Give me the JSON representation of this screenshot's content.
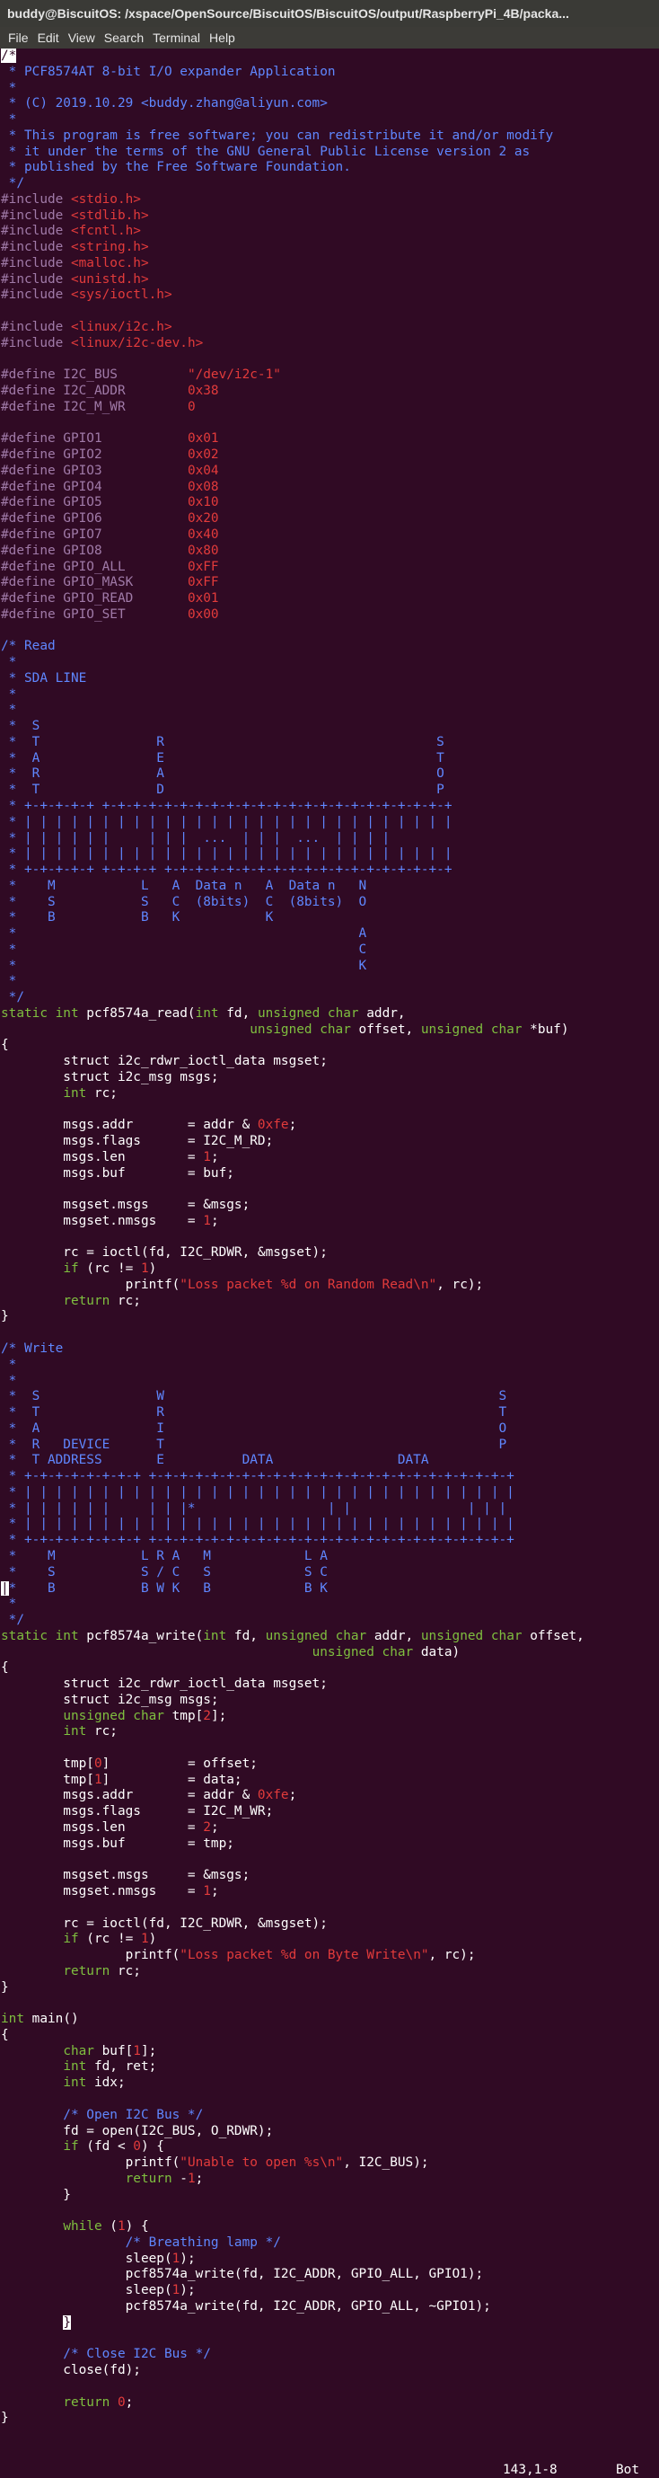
{
  "window": {
    "title": "buddy@BiscuitOS: /xspace/OpenSource/BiscuitOS/BiscuitOS/output/RaspberryPi_4B/packa..."
  },
  "menu": [
    "File",
    "Edit",
    "View",
    "Search",
    "Terminal",
    "Help"
  ],
  "status": {
    "position": "143,1-8",
    "scroll": "Bot"
  },
  "lines": [
    [
      [
        "/*",
        "cursor"
      ]
    ],
    [
      [
        " * PCF8574AT 8-bit I/O expander Application",
        "c"
      ]
    ],
    [
      [
        " *",
        "c"
      ]
    ],
    [
      [
        " * (C) 2019.10.29 <buddy.zhang@aliyun.com>",
        "c"
      ]
    ],
    [
      [
        " *",
        "c"
      ]
    ],
    [
      [
        " * This program is free software; you can redistribute it and/or modify",
        "c"
      ]
    ],
    [
      [
        " * it under the terms of the GNU General Public License version 2 as",
        "c"
      ]
    ],
    [
      [
        " * published by the Free Software Foundation.",
        "c"
      ]
    ],
    [
      [
        " */",
        "c"
      ]
    ],
    [
      [
        "#include ",
        "pp"
      ],
      [
        "<stdio.h>",
        "s"
      ]
    ],
    [
      [
        "#include ",
        "pp"
      ],
      [
        "<stdlib.h>",
        "s"
      ]
    ],
    [
      [
        "#include ",
        "pp"
      ],
      [
        "<fcntl.h>",
        "s"
      ]
    ],
    [
      [
        "#include ",
        "pp"
      ],
      [
        "<string.h>",
        "s"
      ]
    ],
    [
      [
        "#include ",
        "pp"
      ],
      [
        "<malloc.h>",
        "s"
      ]
    ],
    [
      [
        "#include ",
        "pp"
      ],
      [
        "<unistd.h>",
        "s"
      ]
    ],
    [
      [
        "#include ",
        "pp"
      ],
      [
        "<sys/ioctl.h>",
        "s"
      ]
    ],
    [],
    [
      [
        "#include ",
        "pp"
      ],
      [
        "<linux/i2c.h>",
        "s"
      ]
    ],
    [
      [
        "#include ",
        "pp"
      ],
      [
        "<linux/i2c-dev.h>",
        "s"
      ]
    ],
    [],
    [
      [
        "#define I2C_BUS         ",
        "pp"
      ],
      [
        "\"/dev/i2c-1\"",
        "s"
      ]
    ],
    [
      [
        "#define I2C_ADDR        ",
        "pp"
      ],
      [
        "0x38",
        "n"
      ]
    ],
    [
      [
        "#define I2C_M_WR        ",
        "pp"
      ],
      [
        "0",
        "n"
      ]
    ],
    [],
    [
      [
        "#define GPIO1           ",
        "pp"
      ],
      [
        "0x01",
        "n"
      ]
    ],
    [
      [
        "#define GPIO2           ",
        "pp"
      ],
      [
        "0x02",
        "n"
      ]
    ],
    [
      [
        "#define GPIO3           ",
        "pp"
      ],
      [
        "0x04",
        "n"
      ]
    ],
    [
      [
        "#define GPIO4           ",
        "pp"
      ],
      [
        "0x08",
        "n"
      ]
    ],
    [
      [
        "#define GPIO5           ",
        "pp"
      ],
      [
        "0x10",
        "n"
      ]
    ],
    [
      [
        "#define GPIO6           ",
        "pp"
      ],
      [
        "0x20",
        "n"
      ]
    ],
    [
      [
        "#define GPIO7           ",
        "pp"
      ],
      [
        "0x40",
        "n"
      ]
    ],
    [
      [
        "#define GPIO8           ",
        "pp"
      ],
      [
        "0x80",
        "n"
      ]
    ],
    [
      [
        "#define GPIO_ALL        ",
        "pp"
      ],
      [
        "0xFF",
        "n"
      ]
    ],
    [
      [
        "#define GPIO_MASK       ",
        "pp"
      ],
      [
        "0xFF",
        "n"
      ]
    ],
    [
      [
        "#define GPIO_READ       ",
        "pp"
      ],
      [
        "0x01",
        "n"
      ]
    ],
    [
      [
        "#define GPIO_SET        ",
        "pp"
      ],
      [
        "0x00",
        "n"
      ]
    ],
    [],
    [
      [
        "/* Read",
        "c"
      ]
    ],
    [
      [
        " *",
        "c"
      ]
    ],
    [
      [
        " * SDA LINE",
        "c"
      ]
    ],
    [
      [
        " *",
        "c"
      ]
    ],
    [
      [
        " *",
        "c"
      ]
    ],
    [
      [
        " *  S",
        "c"
      ]
    ],
    [
      [
        " *  T               R                                   S",
        "c"
      ]
    ],
    [
      [
        " *  A               E                                   T",
        "c"
      ]
    ],
    [
      [
        " *  R               A                                   O",
        "c"
      ]
    ],
    [
      [
        " *  T               D                                   P",
        "c"
      ]
    ],
    [
      [
        " * +-+-+-+-+ +-+-+-+-+-+-+-+-+-+-+-+-+-+-+-+-+-+-+-+-+-+-+",
        "c"
      ]
    ],
    [
      [
        " * | | | | | | | | | | | | | | | | | | | | | | | | | | | |",
        "c"
      ]
    ],
    [
      [
        " * | | | | | |     | | |  ...  | | |  ...  | | | |",
        "c"
      ]
    ],
    [
      [
        " * | | | | | | | | | | | | | | | | | | | | | | | | | | | |",
        "c"
      ]
    ],
    [
      [
        " * +-+-+-+-+ +-+-+-+ +-+-+-+-+-+-+-+-+-+-+-+-+-+-+-+-+-+-+",
        "c"
      ]
    ],
    [
      [
        " *    M           L   A  Data n   A  Data n   N",
        "c"
      ]
    ],
    [
      [
        " *    S           S   C  (8bits)  C  (8bits)  O",
        "c"
      ]
    ],
    [
      [
        " *    B           B   K           K",
        "c"
      ]
    ],
    [
      [
        " *                                            A",
        "c"
      ]
    ],
    [
      [
        " *                                            C",
        "c"
      ]
    ],
    [
      [
        " *                                            K",
        "c"
      ]
    ],
    [
      [
        " *",
        "c"
      ]
    ],
    [
      [
        " */",
        "c"
      ]
    ],
    [
      [
        "static int",
        "t"
      ],
      [
        " pcf8574a_read(",
        "p"
      ],
      [
        "int",
        "t"
      ],
      [
        " fd, ",
        "p"
      ],
      [
        "unsigned char",
        "t"
      ],
      [
        " addr,",
        "p"
      ]
    ],
    [
      [
        "                                ",
        "p"
      ],
      [
        "unsigned char",
        "t"
      ],
      [
        " offset, ",
        "p"
      ],
      [
        "unsigned char",
        "t"
      ],
      [
        " *buf)",
        "p"
      ]
    ],
    [
      [
        "{",
        "p"
      ]
    ],
    [
      [
        "        struct i2c_rdwr_ioctl_data msgset;",
        "p"
      ]
    ],
    [
      [
        "        struct i2c_msg msgs;",
        "p"
      ]
    ],
    [
      [
        "        ",
        "p"
      ],
      [
        "int",
        "t"
      ],
      [
        " rc;",
        "p"
      ]
    ],
    [],
    [
      [
        "        msgs.addr       = addr & ",
        "p"
      ],
      [
        "0xfe",
        "n"
      ],
      [
        ";",
        "p"
      ]
    ],
    [
      [
        "        msgs.flags      = I2C_M_RD;",
        "p"
      ]
    ],
    [
      [
        "        msgs.len        = ",
        "p"
      ],
      [
        "1",
        "n"
      ],
      [
        ";",
        "p"
      ]
    ],
    [
      [
        "        msgs.buf        = buf;",
        "p"
      ]
    ],
    [],
    [
      [
        "        msgset.msgs     = &msgs;",
        "p"
      ]
    ],
    [
      [
        "        msgset.nmsgs    = ",
        "p"
      ],
      [
        "1",
        "n"
      ],
      [
        ";",
        "p"
      ]
    ],
    [],
    [
      [
        "        rc = ioctl(fd, I2C_RDWR, &msgset);",
        "p"
      ]
    ],
    [
      [
        "        ",
        "p"
      ],
      [
        "if",
        "t"
      ],
      [
        " (rc != ",
        "p"
      ],
      [
        "1",
        "n"
      ],
      [
        ")",
        "p"
      ]
    ],
    [
      [
        "                printf(",
        "p"
      ],
      [
        "\"Loss packet %d on Random Read\\n\"",
        "s"
      ],
      [
        ", rc);",
        "p"
      ]
    ],
    [
      [
        "        ",
        "p"
      ],
      [
        "return",
        "t"
      ],
      [
        " rc;",
        "p"
      ]
    ],
    [
      [
        "}",
        "p"
      ]
    ],
    [],
    [
      [
        "/* Write",
        "c"
      ]
    ],
    [
      [
        " *",
        "c"
      ]
    ],
    [
      [
        " *",
        "c"
      ]
    ],
    [
      [
        " *  S               W                                           S",
        "c"
      ]
    ],
    [
      [
        " *  T               R                                           T",
        "c"
      ]
    ],
    [
      [
        " *  A               I                                           O",
        "c"
      ]
    ],
    [
      [
        " *  R   DEVICE      T                                           P",
        "c"
      ]
    ],
    [
      [
        " *  T ADDRESS       E          DATA                DATA",
        "c"
      ]
    ],
    [
      [
        " * +-+-+-+-+-+-+-+ +-+-+-+-+-+-+-+-+-+-+-+-+-+-+-+-+-+-+-+-+-+-+-+",
        "c"
      ]
    ],
    [
      [
        " * | | | | | | | | | | | | | | | | | | | | | | | | | | | | | | | |",
        "c"
      ]
    ],
    [
      [
        " * | | | | | |     | | |*                 | |               | | |",
        "c"
      ]
    ],
    [
      [
        " * | | | | | | | | | | | | | | | | | | | | | | | | | | | | | | | |",
        "c"
      ]
    ],
    [
      [
        " * +-+-+-+-+-+-+-+ +-+-+-+-+-+-+-+-+-+-+-+-+-+-+-+-+-+-+-+-+-+-+-+",
        "c"
      ]
    ],
    [
      [
        " *    M           L R A   M            L A",
        "c"
      ]
    ],
    [
      [
        " *    S           S / C   S            S C",
        "c"
      ]
    ],
    [
      [
        "|",
        "cursor"
      ],
      [
        "*    B           B W K   B            B K",
        "c"
      ]
    ],
    [
      [
        " *",
        "c"
      ]
    ],
    [
      [
        " */",
        "c"
      ]
    ],
    [
      [
        "static int",
        "t"
      ],
      [
        " pcf8574a_write(",
        "p"
      ],
      [
        "int",
        "t"
      ],
      [
        " fd, ",
        "p"
      ],
      [
        "unsigned char",
        "t"
      ],
      [
        " addr, ",
        "p"
      ],
      [
        "unsigned char",
        "t"
      ],
      [
        " offset,",
        "p"
      ]
    ],
    [
      [
        "                                        ",
        "p"
      ],
      [
        "unsigned char",
        "t"
      ],
      [
        " data)",
        "p"
      ]
    ],
    [
      [
        "{",
        "p"
      ]
    ],
    [
      [
        "        struct i2c_rdwr_ioctl_data msgset;",
        "p"
      ]
    ],
    [
      [
        "        struct i2c_msg msgs;",
        "p"
      ]
    ],
    [
      [
        "        ",
        "p"
      ],
      [
        "unsigned char",
        "t"
      ],
      [
        " tmp[",
        "p"
      ],
      [
        "2",
        "n"
      ],
      [
        "];",
        "p"
      ]
    ],
    [
      [
        "        ",
        "p"
      ],
      [
        "int",
        "t"
      ],
      [
        " rc;",
        "p"
      ]
    ],
    [],
    [
      [
        "        tmp[",
        "p"
      ],
      [
        "0",
        "n"
      ],
      [
        "]          = offset;",
        "p"
      ]
    ],
    [
      [
        "        tmp[",
        "p"
      ],
      [
        "1",
        "n"
      ],
      [
        "]          = data;",
        "p"
      ]
    ],
    [
      [
        "        msgs.addr       = addr & ",
        "p"
      ],
      [
        "0xfe",
        "n"
      ],
      [
        ";",
        "p"
      ]
    ],
    [
      [
        "        msgs.flags      = I2C_M_WR;",
        "p"
      ]
    ],
    [
      [
        "        msgs.len        = ",
        "p"
      ],
      [
        "2",
        "n"
      ],
      [
        ";",
        "p"
      ]
    ],
    [
      [
        "        msgs.buf        = tmp;",
        "p"
      ]
    ],
    [],
    [
      [
        "        msgset.msgs     = &msgs;",
        "p"
      ]
    ],
    [
      [
        "        msgset.nmsgs    = ",
        "p"
      ],
      [
        "1",
        "n"
      ],
      [
        ";",
        "p"
      ]
    ],
    [],
    [
      [
        "        rc = ioctl(fd, I2C_RDWR, &msgset);",
        "p"
      ]
    ],
    [
      [
        "        ",
        "p"
      ],
      [
        "if",
        "t"
      ],
      [
        " (rc != ",
        "p"
      ],
      [
        "1",
        "n"
      ],
      [
        ")",
        "p"
      ]
    ],
    [
      [
        "                printf(",
        "p"
      ],
      [
        "\"Loss packet %d on Byte Write\\n\"",
        "s"
      ],
      [
        ", rc);",
        "p"
      ]
    ],
    [
      [
        "        ",
        "p"
      ],
      [
        "return",
        "t"
      ],
      [
        " rc;",
        "p"
      ]
    ],
    [
      [
        "}",
        "p"
      ]
    ],
    [],
    [
      [
        "int",
        "t"
      ],
      [
        " main()",
        "p"
      ]
    ],
    [
      [
        "{",
        "p"
      ]
    ],
    [
      [
        "        ",
        "p"
      ],
      [
        "char",
        "t"
      ],
      [
        " buf[",
        "p"
      ],
      [
        "1",
        "n"
      ],
      [
        "];",
        "p"
      ]
    ],
    [
      [
        "        ",
        "p"
      ],
      [
        "int",
        "t"
      ],
      [
        " fd, ret;",
        "p"
      ]
    ],
    [
      [
        "        ",
        "p"
      ],
      [
        "int",
        "t"
      ],
      [
        " idx;",
        "p"
      ]
    ],
    [],
    [
      [
        "        /* Open I2C Bus */",
        "c"
      ]
    ],
    [
      [
        "        fd = open(I2C_BUS, O_RDWR);",
        "p"
      ]
    ],
    [
      [
        "        ",
        "p"
      ],
      [
        "if",
        "t"
      ],
      [
        " (fd < ",
        "p"
      ],
      [
        "0",
        "n"
      ],
      [
        ") {",
        "p"
      ]
    ],
    [
      [
        "                printf(",
        "p"
      ],
      [
        "\"Unable to open %s\\n\"",
        "s"
      ],
      [
        ", I2C_BUS);",
        "p"
      ]
    ],
    [
      [
        "                ",
        "p"
      ],
      [
        "return",
        "t"
      ],
      [
        " -",
        "p"
      ],
      [
        "1",
        "n"
      ],
      [
        ";",
        "p"
      ]
    ],
    [
      [
        "        }",
        "p"
      ]
    ],
    [],
    [
      [
        "        ",
        "p"
      ],
      [
        "while",
        "t"
      ],
      [
        " (",
        "p"
      ],
      [
        "1",
        "n"
      ],
      [
        ") {",
        "p"
      ]
    ],
    [
      [
        "                /* Breathing lamp */",
        "c"
      ]
    ],
    [
      [
        "                sleep(",
        "p"
      ],
      [
        "1",
        "n"
      ],
      [
        ");",
        "p"
      ]
    ],
    [
      [
        "                pcf8574a_write(fd, I2C_ADDR, GPIO_ALL, GPIO1);",
        "p"
      ]
    ],
    [
      [
        "                sleep(",
        "p"
      ],
      [
        "1",
        "n"
      ],
      [
        ");",
        "p"
      ]
    ],
    [
      [
        "                pcf8574a_write(fd, I2C_ADDR, GPIO_ALL, ~GPIO1);",
        "p"
      ]
    ],
    [
      [
        "        ",
        "p"
      ],
      [
        "}",
        "cursor"
      ]
    ],
    [],
    [
      [
        "        /* Close I2C Bus */",
        "c"
      ]
    ],
    [
      [
        "        close(fd);",
        "p"
      ]
    ],
    [],
    [
      [
        "        ",
        "p"
      ],
      [
        "return",
        "t"
      ],
      [
        " ",
        "p"
      ],
      [
        "0",
        "n"
      ],
      [
        ";",
        "p"
      ]
    ],
    [
      [
        "}",
        "p"
      ]
    ]
  ]
}
